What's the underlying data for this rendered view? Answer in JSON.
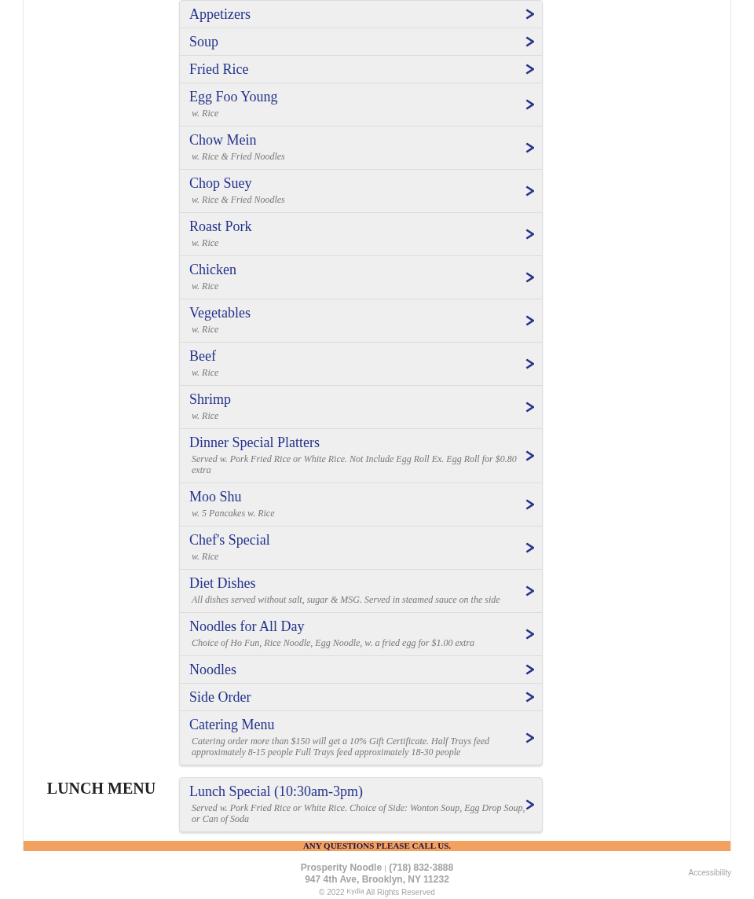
{
  "sections": [
    {
      "items": [
        {
          "name": "Appetizers"
        },
        {
          "name": "Soup"
        },
        {
          "name": "Fried Rice"
        },
        {
          "name": "Egg Foo Young",
          "description": "w. Rice"
        },
        {
          "name": "Chow Mein",
          "description": "w. Rice & Fried Noodles"
        },
        {
          "name": "Chop Suey",
          "description": "w. Rice & Fried Noodles"
        },
        {
          "name": "Roast Pork",
          "description": "w. Rice"
        },
        {
          "name": "Chicken",
          "description": "w. Rice"
        },
        {
          "name": "Vegetables",
          "description": "w. Rice"
        },
        {
          "name": "Beef",
          "description": "w. Rice"
        },
        {
          "name": "Shrimp",
          "description": "w. Rice"
        },
        {
          "name": "Dinner Special Platters",
          "description": "Served w. Pork Fried Rice or White Rice. Not Include Egg Roll Ex. Egg Roll for $0.80 extra"
        },
        {
          "name": "Moo Shu",
          "description": "w. 5 Pancakes w. Rice"
        },
        {
          "name": "Chef's Special",
          "description": "w. Rice"
        },
        {
          "name": "Diet Dishes",
          "description": "All dishes served without salt, sugar & MSG. Served in steamed sauce on the side"
        },
        {
          "name": "Noodles for All Day",
          "description": "Choice of Ho Fun, Rice Noodle, Egg Noodle, w. a fried egg for $1.00 extra"
        },
        {
          "name": "Noodles"
        },
        {
          "name": "Side Order"
        },
        {
          "name": "Catering Menu",
          "description": "Catering order more than $150 will get a 10% Gift Certificate. Half Trays feed approximately 8-15 people Full Trays feed approximately 18-30 people"
        }
      ]
    },
    {
      "heading": "LUNCH MENU",
      "items": [
        {
          "name": "Lunch Special (10:30am-3pm)",
          "description": "Served w. Pork Fried Rice or White Rice. Choice of Side: Wonton Soup, Egg Drop Soup, or Can of Soda"
        }
      ]
    }
  ],
  "banner": "ANY QUESTIONS PLEASE CALL US.",
  "footer": {
    "business_name": "Prosperity Noodle",
    "separator": "|",
    "phone": "(718) 832-3888",
    "address": "947 4th Ave, Brooklyn, NY 11232",
    "copyright": "© 2022",
    "credit_link": "Kydia",
    "rights": "All Rights Reserved",
    "accessibility_link": "Accessibility"
  }
}
